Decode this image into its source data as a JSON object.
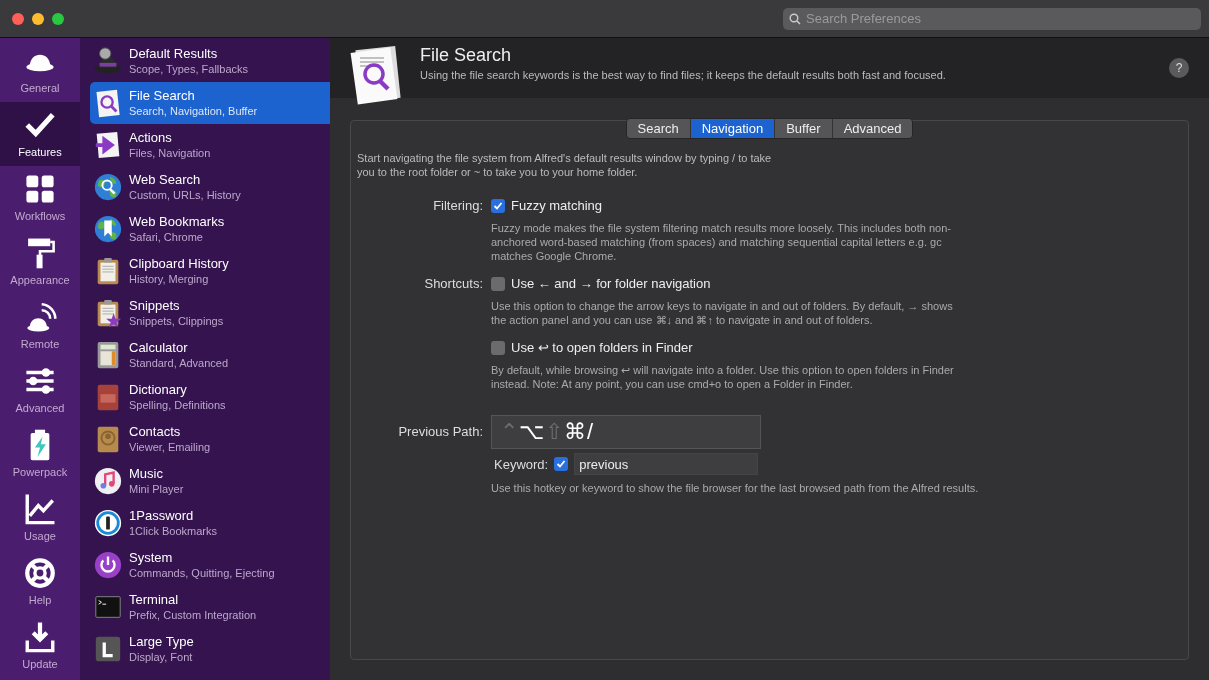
{
  "window": {
    "search": {
      "placeholder": "Search Preferences"
    }
  },
  "rail": [
    {
      "label": "General",
      "selected": false
    },
    {
      "label": "Features",
      "selected": true
    },
    {
      "label": "Workflows",
      "selected": false
    },
    {
      "label": "Appearance",
      "selected": false
    },
    {
      "label": "Remote",
      "selected": false
    },
    {
      "label": "Advanced",
      "selected": false
    },
    {
      "label": "Powerpack",
      "selected": false
    },
    {
      "label": "Usage",
      "selected": false
    },
    {
      "label": "Help",
      "selected": false
    },
    {
      "label": "Update",
      "selected": false
    }
  ],
  "features": [
    {
      "title": "Default Results",
      "subtitle": "Scope, Types, Fallbacks",
      "selected": false
    },
    {
      "title": "File Search",
      "subtitle": "Search, Navigation, Buffer",
      "selected": true
    },
    {
      "title": "Actions",
      "subtitle": "Files, Navigation",
      "selected": false
    },
    {
      "title": "Web Search",
      "subtitle": "Custom, URLs, History",
      "selected": false
    },
    {
      "title": "Web Bookmarks",
      "subtitle": "Safari, Chrome",
      "selected": false
    },
    {
      "title": "Clipboard History",
      "subtitle": "History, Merging",
      "selected": false
    },
    {
      "title": "Snippets",
      "subtitle": "Snippets, Clippings",
      "selected": false
    },
    {
      "title": "Calculator",
      "subtitle": "Standard, Advanced",
      "selected": false
    },
    {
      "title": "Dictionary",
      "subtitle": "Spelling, Definitions",
      "selected": false
    },
    {
      "title": "Contacts",
      "subtitle": "Viewer, Emailing",
      "selected": false
    },
    {
      "title": "Music",
      "subtitle": "Mini Player",
      "selected": false
    },
    {
      "title": "1Password",
      "subtitle": "1Click Bookmarks",
      "selected": false
    },
    {
      "title": "System",
      "subtitle": "Commands, Quitting, Ejecting",
      "selected": false
    },
    {
      "title": "Terminal",
      "subtitle": "Prefix, Custom Integration",
      "selected": false
    },
    {
      "title": "Large Type",
      "subtitle": "Display, Font",
      "selected": false
    }
  ],
  "header": {
    "title": "File Search",
    "help": "?",
    "description": "Using the file search keywords is the best way to find files; it keeps the default results both fast and focused."
  },
  "tabs": [
    {
      "label": "Search",
      "selected": false
    },
    {
      "label": "Navigation",
      "selected": true
    },
    {
      "label": "Buffer",
      "selected": false
    },
    {
      "label": "Advanced",
      "selected": false
    }
  ],
  "intro": "Start navigating the file system from Alfred's default results window by typing / to take you to the root folder or ~ to take you to your home folder.",
  "settings": [
    {
      "label": "Filtering:",
      "option": "Fuzzy matching",
      "checked": true,
      "help": "Fuzzy mode makes the file system filtering match results more loosely. This includes both non-anchored word-based matching (from spaces) and matching sequential capital letters e.g. gc matches Google Chrome."
    },
    {
      "label": "Shortcuts:",
      "option": "Use ← and → for folder navigation",
      "checked": false,
      "help": "Use this option to change the arrow keys to navigate in and out of folders. By default, → shows the action panel and you can use ⌘↓ and ⌘↑ to navigate in and out of folders."
    },
    {
      "option": "Use ↩ to open folders in Finder",
      "checked": false,
      "help": "By default, while browsing ↩ will navigate into a folder. Use this option to open folders in Finder instead. Note: At any point, you can use cmd+o to open a Folder in Finder."
    }
  ],
  "previous_path": {
    "label": "Previous Path:",
    "keys": [
      {
        "label": "⌃",
        "on": false
      },
      {
        "label": "⌥",
        "on": true
      },
      {
        "label": "⇧",
        "on": false
      },
      {
        "label": "⌘",
        "on": true
      },
      {
        "label": "/",
        "on": true
      }
    ],
    "keyword_label": "Keyword:",
    "keyword_checked": true,
    "keyword": "previous",
    "help": "Use this hotkey or keyword to show the file browser for the last browsed path from the Alfred results."
  }
}
